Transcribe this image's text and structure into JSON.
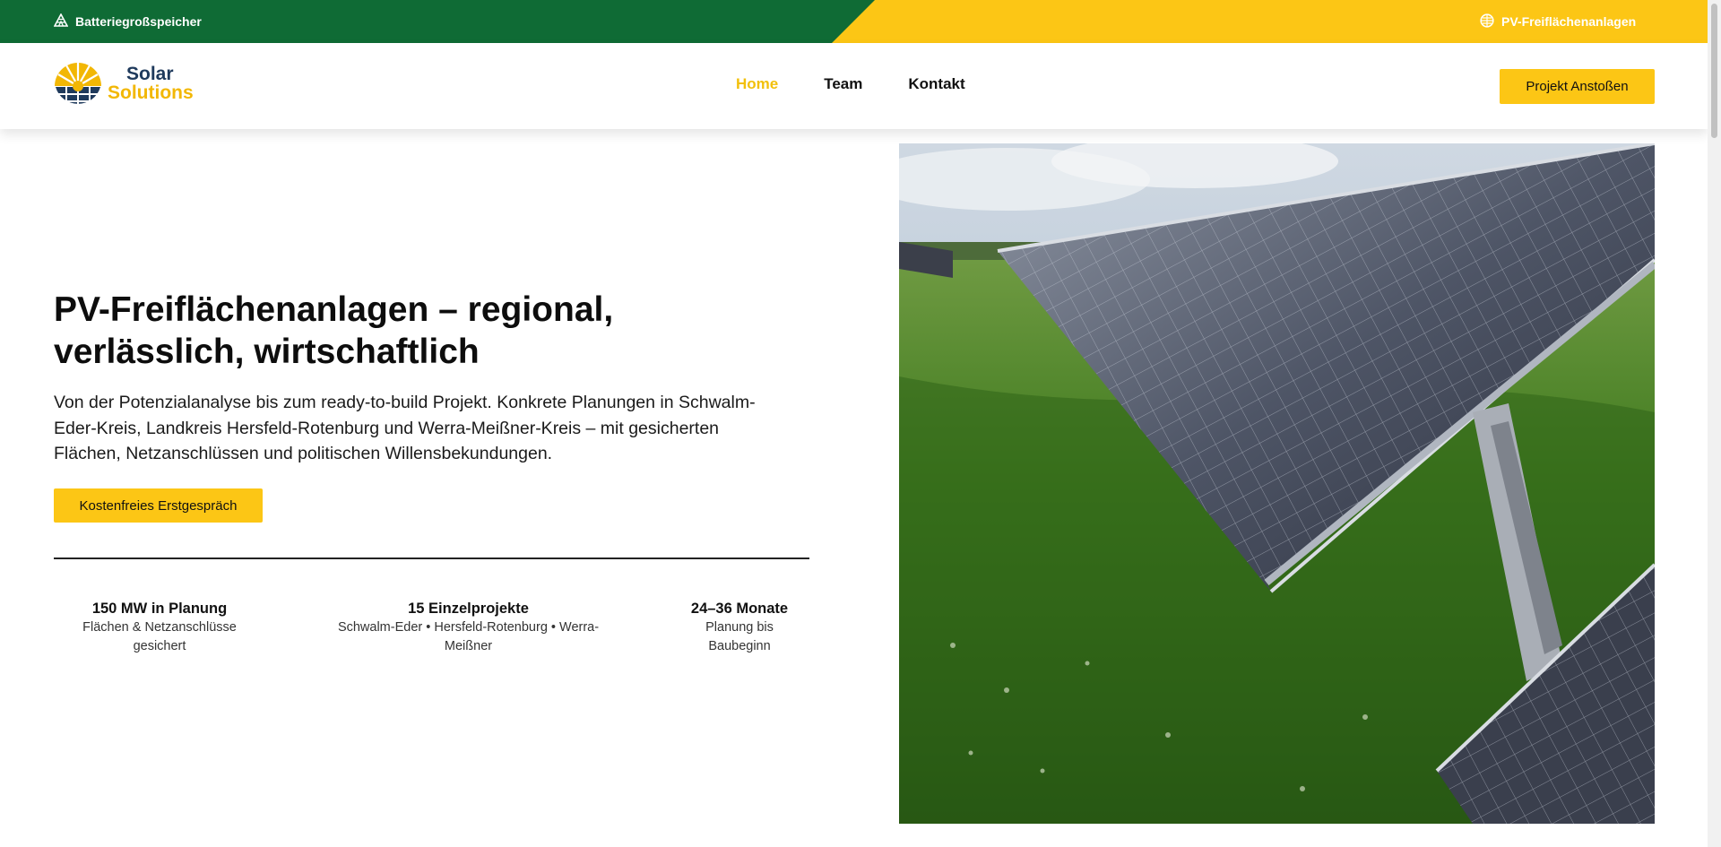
{
  "topbar": {
    "left_link": "Batteriegroßspeicher",
    "left_icon": "battery-grid-icon",
    "right_link": "PV-Freiflächenanlagen",
    "right_icon": "sun-icon",
    "colors": {
      "green": "#0f6b35",
      "yellow": "#fcc615"
    }
  },
  "header": {
    "logo": {
      "line1": "Solar",
      "line2": "Solutions"
    },
    "nav": [
      {
        "label": "Home",
        "active": true
      },
      {
        "label": "Team",
        "active": false
      },
      {
        "label": "Kontakt",
        "active": false
      }
    ],
    "cta": "Projekt Anstoßen"
  },
  "hero": {
    "title": "PV-Freiflächenanlagen – regional, verlässlich, wirtschaftlich",
    "subtitle": "Von der Potenzialanalyse bis zum ready-to-build Projekt. Konkrete Planungen in Schwalm-Eder-Kreis, Landkreis Hersfeld-Rotenburg und Werra-Meißner-Kreis – mit gesicherten Flächen, Netzanschlüssen und politischen Willensbekundungen.",
    "button": "Kostenfreies Erstgespräch",
    "image_alt": "solar-panels-in-field-image"
  },
  "stats": [
    {
      "title": "150 MW in Planung",
      "desc": "Flächen & Netzanschlüsse gesichert"
    },
    {
      "title": "15 Einzelprojekte",
      "desc": "Schwalm-Eder • Hersfeld-Rotenburg • Werra-Meißner"
    },
    {
      "title": "24–36 Monate",
      "desc": "Planung bis Baubeginn"
    }
  ]
}
